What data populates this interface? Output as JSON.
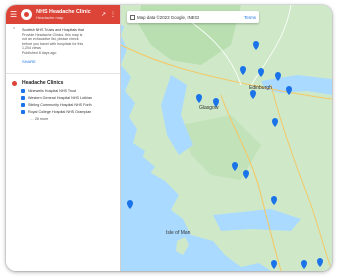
{
  "header": {
    "title": "NHS Headache Clinic",
    "subtitle": "Headache map",
    "menu_icon": "menu-icon",
    "share_icon": "share-icon",
    "more_icon": "more-vert-icon"
  },
  "description": {
    "lines": [
      "Scottish NHS Trusts and Hospitals that",
      "Provide Headache Clinics, this map is",
      "not an exhaustive list, please check",
      "before you travel with hospitals for this"
    ],
    "meta": [
      "1,204 views",
      "Published 8 days ago"
    ],
    "share_label": "SHARE"
  },
  "layer": {
    "name": "Headache Clinics",
    "items": [
      "Ninewells Hospital NHS Trust",
      "Western General Hospital NHS Lothian",
      "Stirling Community Hospital NHS Forth",
      "Royal College Hospital NHS Grampian"
    ],
    "more_label": "… 28 more"
  },
  "map": {
    "search_text": "Map data ©2023 Google, INEGI",
    "search_link": "Terms",
    "place_labels": [
      "Edinburgh",
      "Glasgow",
      "Isle of Man"
    ]
  },
  "colors": {
    "accent": "#db4437",
    "pin": "#1a73e8",
    "water": "#aadaff",
    "land": "#c5e8c5"
  }
}
